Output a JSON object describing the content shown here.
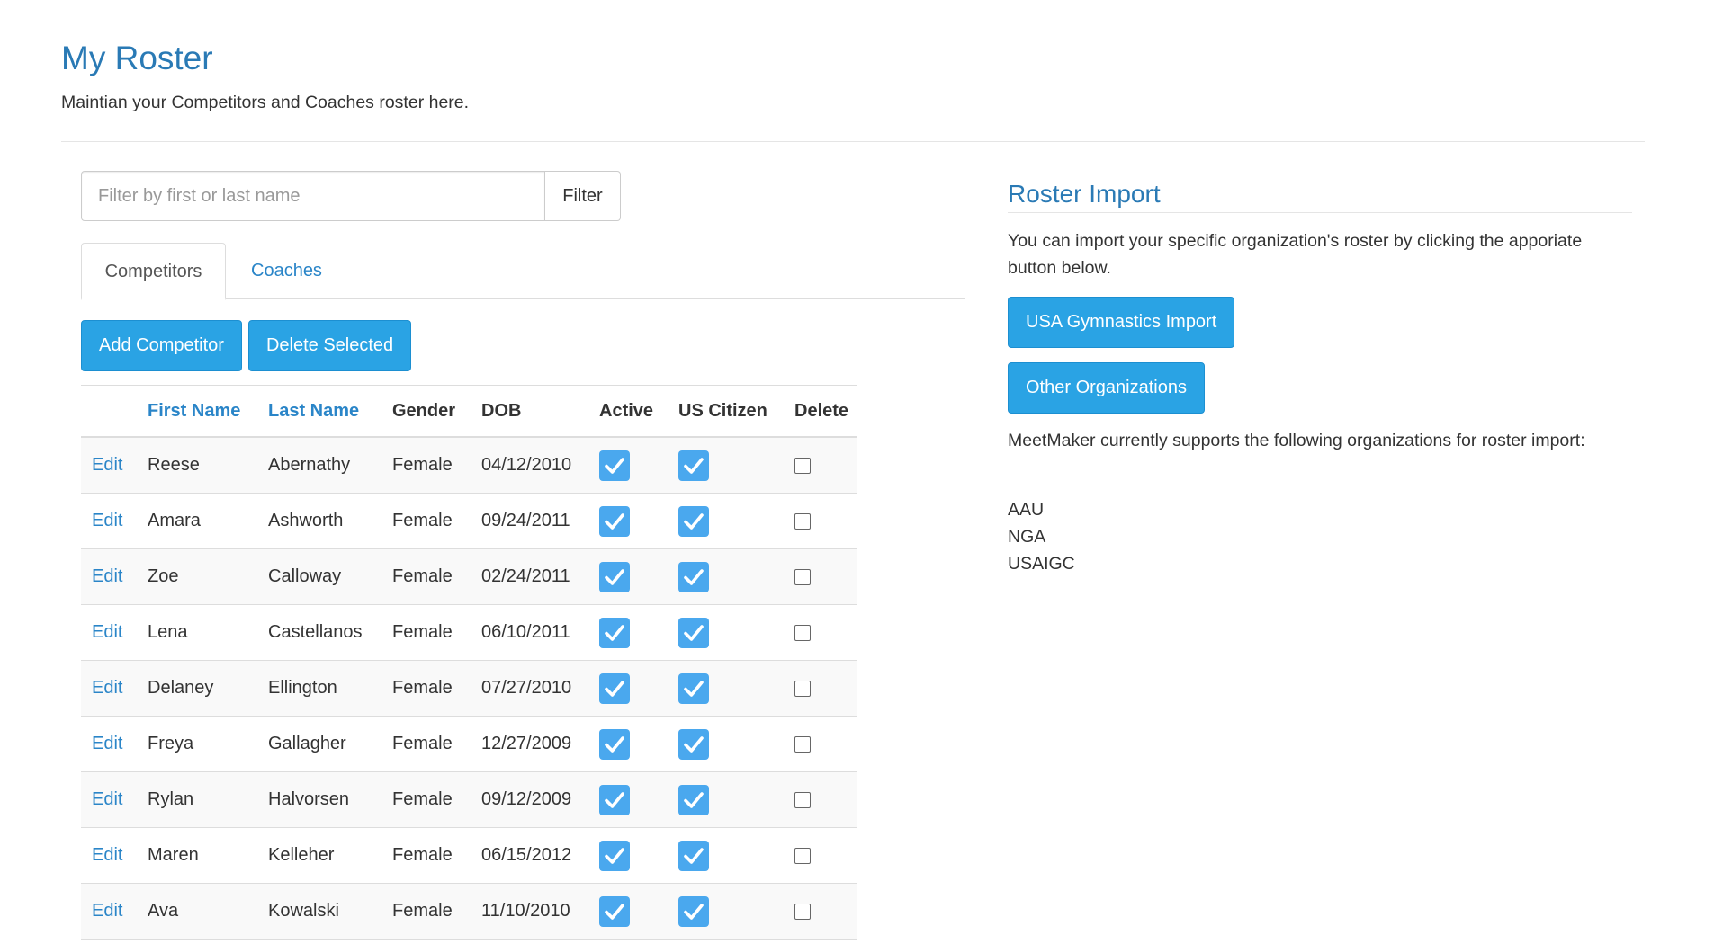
{
  "header": {
    "title": "My Roster",
    "subtitle": "Maintian your Competitors and Coaches roster here."
  },
  "filter": {
    "placeholder": "Filter by first or last name",
    "value": "",
    "button_label": "Filter"
  },
  "tabs": [
    {
      "label": "Competitors",
      "active": true
    },
    {
      "label": "Coaches",
      "active": false
    }
  ],
  "actions": {
    "add_label": "Add Competitor",
    "delete_label": "Delete Selected"
  },
  "table": {
    "columns": {
      "edit": "",
      "first_name": "First Name",
      "last_name": "Last Name",
      "gender": "Gender",
      "dob": "DOB",
      "active": "Active",
      "us_citizen": "US Citizen",
      "delete": "Delete"
    },
    "rows": [
      {
        "edit": "Edit",
        "first": "Reese",
        "last": "Abernathy",
        "gender": "Female",
        "dob": "04/12/2010",
        "active": true,
        "citizen": true,
        "delete": false
      },
      {
        "edit": "Edit",
        "first": "Amara",
        "last": "Ashworth",
        "gender": "Female",
        "dob": "09/24/2011",
        "active": true,
        "citizen": true,
        "delete": false
      },
      {
        "edit": "Edit",
        "first": "Zoe",
        "last": "Calloway",
        "gender": "Female",
        "dob": "02/24/2011",
        "active": true,
        "citizen": true,
        "delete": false
      },
      {
        "edit": "Edit",
        "first": "Lena",
        "last": "Castellanos",
        "gender": "Female",
        "dob": "06/10/2011",
        "active": true,
        "citizen": true,
        "delete": false
      },
      {
        "edit": "Edit",
        "first": "Delaney",
        "last": "Ellington",
        "gender": "Female",
        "dob": "07/27/2010",
        "active": true,
        "citizen": true,
        "delete": false
      },
      {
        "edit": "Edit",
        "first": "Freya",
        "last": "Gallagher",
        "gender": "Female",
        "dob": "12/27/2009",
        "active": true,
        "citizen": true,
        "delete": false
      },
      {
        "edit": "Edit",
        "first": "Rylan",
        "last": "Halvorsen",
        "gender": "Female",
        "dob": "09/12/2009",
        "active": true,
        "citizen": true,
        "delete": false
      },
      {
        "edit": "Edit",
        "first": "Maren",
        "last": "Kelleher",
        "gender": "Female",
        "dob": "06/15/2012",
        "active": true,
        "citizen": true,
        "delete": false
      },
      {
        "edit": "Edit",
        "first": "Ava",
        "last": "Kowalski",
        "gender": "Female",
        "dob": "11/10/2010",
        "active": true,
        "citizen": true,
        "delete": false
      }
    ]
  },
  "import": {
    "heading": "Roster Import",
    "description": "You can import your specific organization's roster by clicking the apporiate button below.",
    "usag_button": "USA Gymnastics Import",
    "other_button": "Other Organizations",
    "support_text": "MeetMaker currently supports the following organizations for roster import:",
    "organizations": [
      "AAU",
      "NGA",
      "USAIGC"
    ]
  },
  "colors": {
    "title_blue": "#2a7ab5",
    "link_blue": "#2a85c8",
    "button_blue": "#2aa3e4",
    "checkbox_blue": "#4aa8ee"
  },
  "icons": {
    "checked": "checkmark-icon",
    "unchecked": "empty-checkbox"
  }
}
